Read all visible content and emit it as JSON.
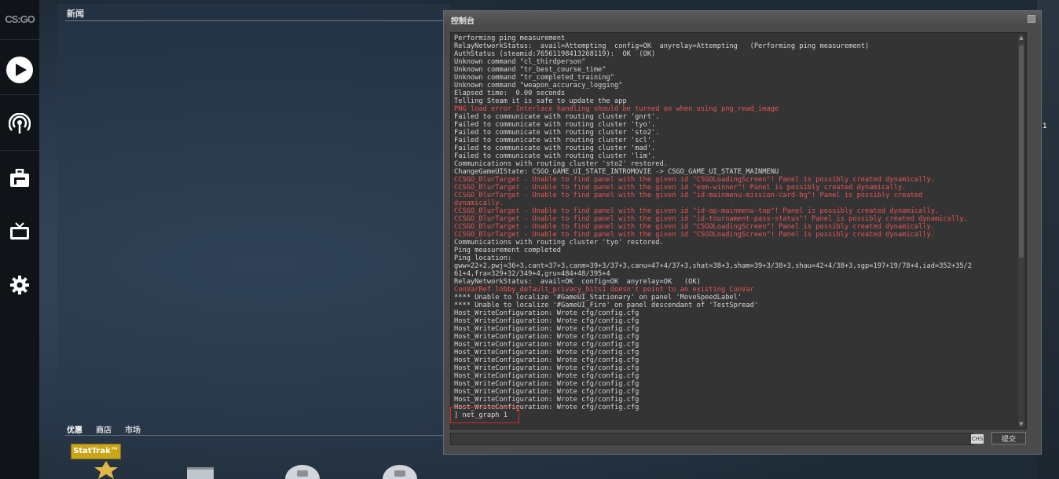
{
  "app": {
    "logo_text": "CS:GO"
  },
  "sidebar": {
    "items": [
      {
        "name": "play",
        "icon": "play-icon"
      },
      {
        "name": "watch",
        "icon": "broadcast-icon"
      },
      {
        "name": "inventory",
        "icon": "briefcase-icon"
      },
      {
        "name": "tv",
        "icon": "tv-icon"
      },
      {
        "name": "settings",
        "icon": "gear-icon"
      }
    ]
  },
  "news": {
    "title": "新闻"
  },
  "store_tabs": {
    "tabs": [
      {
        "label": "优惠",
        "active": true
      },
      {
        "label": "商店",
        "active": false
      },
      {
        "label": "市场",
        "active": false
      }
    ],
    "badge": "StatTrak™"
  },
  "console": {
    "title": "控制台",
    "lines": [
      {
        "text": "Performing ping measurement",
        "error": false
      },
      {
        "text": "RelayNetworkStatus:  avail=Attempting  config=OK  anyrelay=Attempting   (Performing ping measurement)",
        "error": false
      },
      {
        "text": "AuthStatus (steamid:76561198413268119):  OK  (OK)",
        "error": false
      },
      {
        "text": "Unknown command \"cl_thirdperson\"",
        "error": false
      },
      {
        "text": "Unknown command \"tr_best_course_time\"",
        "error": false
      },
      {
        "text": "Unknown command \"tr_completed_training\"",
        "error": false
      },
      {
        "text": "Unknown command \"weapon_accuracy_logging\"",
        "error": false
      },
      {
        "text": "Elapsed time:  0.00 seconds",
        "error": false
      },
      {
        "text": "Telling Steam it is safe to update the app",
        "error": false
      },
      {
        "text": "PNG load error Interlace handling should be turned on when using png_read_image",
        "error": true
      },
      {
        "text": "Failed to communicate with routing cluster 'gnrt'.",
        "error": false
      },
      {
        "text": "Failed to communicate with routing cluster 'tyo'.",
        "error": false
      },
      {
        "text": "Failed to communicate with routing cluster 'sto2'.",
        "error": false
      },
      {
        "text": "Failed to communicate with routing cluster 'scl'.",
        "error": false
      },
      {
        "text": "Failed to communicate with routing cluster 'mad'.",
        "error": false
      },
      {
        "text": "Failed to communicate with routing cluster 'lim'.",
        "error": false
      },
      {
        "text": "Communications with routing cluster 'sto2' restored.",
        "error": false
      },
      {
        "text": "ChangeGameUIState: CSGO_GAME_UI_STATE_INTROMOVIE -> CSGO_GAME_UI_STATE_MAINMENU",
        "error": false
      },
      {
        "text": "CCSGO_BlurTarget - Unable to find panel with the given id \"CSGOLoadingScreen\"! Panel is possibly created dynamically.",
        "error": true
      },
      {
        "text": "CCSGO_BlurTarget - Unable to find panel with the given id \"eom-winner\"! Panel is possibly created dynamically.",
        "error": true
      },
      {
        "text": "CCSGO_BlurTarget - Unable to find panel with the given id \"id-mainmenu-mission-card-bg\"! Panel is possibly created",
        "error": true
      },
      {
        "text": "dynamically.",
        "error": true
      },
      {
        "text": "CCSGO_BlurTarget - Unable to find panel with the given id \"id-op-mainmenu-top\"! Panel is possibly created dynamically.",
        "error": true
      },
      {
        "text": "CCSGO_BlurTarget - Unable to find panel with the given id \"id-tournament-pass-status\"! Panel is possibly created dynamically.",
        "error": true
      },
      {
        "text": "CCSGO_BlurTarget - Unable to find panel with the given id \"CSGOLoadingScreen\"! Panel is possibly created dynamically.",
        "error": true
      },
      {
        "text": "CCSGO_BlurTarget - Unable to find panel with the given id \"CSGOLoadingScreen\"! Panel is possibly created dynamically.",
        "error": true
      },
      {
        "text": "Communications with routing cluster 'tyo' restored.",
        "error": false
      },
      {
        "text": "Ping measurement completed",
        "error": false
      },
      {
        "text": "Ping location:",
        "error": false
      },
      {
        "text": "gww=22+2,pwj=36+3,cant=37+3,canm=39+3/37+3,canu=47+4/37+3,shat=38+3,sham=39+3/38+3,shau=42+4/38+3,sgp=197+19/78+4,iad=352+35/2",
        "error": false
      },
      {
        "text": "61+4,fra=329+32/349+4,gru=484+48/395+4",
        "error": false
      },
      {
        "text": "RelayNetworkStatus:  avail=OK  config=OK  anyrelay=OK   (OK)",
        "error": false
      },
      {
        "text": "ConVarRef lobby_default_privacy_bits1 doesn't point to an existing ConVar",
        "error": true
      },
      {
        "text": "**** Unable to localize '#GameUI_Stationary' on panel 'MoveSpeedLabel'",
        "error": false
      },
      {
        "text": "**** Unable to localize '#GameUI_Fire' on panel descendant of 'TestSpread'",
        "error": false
      },
      {
        "text": "Host_WriteConfiguration: Wrote cfg/config.cfg",
        "error": false
      },
      {
        "text": "Host_WriteConfiguration: Wrote cfg/config.cfg",
        "error": false
      },
      {
        "text": "Host_WriteConfiguration: Wrote cfg/config.cfg",
        "error": false
      },
      {
        "text": "Host_WriteConfiguration: Wrote cfg/config.cfg",
        "error": false
      },
      {
        "text": "Host_WriteConfiguration: Wrote cfg/config.cfg",
        "error": false
      },
      {
        "text": "Host_WriteConfiguration: Wrote cfg/config.cfg",
        "error": false
      },
      {
        "text": "Host_WriteConfiguration: Wrote cfg/config.cfg",
        "error": false
      },
      {
        "text": "Host_WriteConfiguration: Wrote cfg/config.cfg",
        "error": false
      },
      {
        "text": "Host_WriteConfiguration: Wrote cfg/config.cfg",
        "error": false
      },
      {
        "text": "Host_WriteConfiguration: Wrote cfg/config.cfg",
        "error": false
      },
      {
        "text": "Host_WriteConfiguration: Wrote cfg/config.cfg",
        "error": false
      },
      {
        "text": "Host_WriteConfiguration: Wrote cfg/config.cfg",
        "error": false
      },
      {
        "text": "Host_WriteConfiguration: Wrote cfg/config.cfg",
        "error": false
      },
      {
        "text": "] net_graph 1",
        "error": false
      }
    ],
    "input_value": "",
    "lang_badge": "CHS",
    "submit_label": "提交"
  },
  "right_edge": {
    "number": "1"
  },
  "colors": {
    "error_text": "#e85656",
    "highlight_border": "#d12a2a",
    "stattrak_gold": "#c9a617"
  }
}
